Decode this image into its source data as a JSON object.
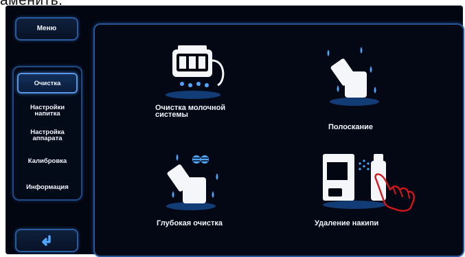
{
  "top_caption": "аменить.",
  "menu": {
    "label": "Меню"
  },
  "sidebar": {
    "items": [
      {
        "label": "Очистка",
        "active": true
      },
      {
        "label": "Настройки напитка",
        "active": false
      },
      {
        "label": "Настройка аппарата",
        "active": false
      },
      {
        "label": "Калибровка",
        "active": false
      },
      {
        "label": "Информация",
        "active": false
      }
    ]
  },
  "back_button": {
    "icon": "back-arrow-icon"
  },
  "tiles": [
    {
      "label": "Очистка молочной системы",
      "icon": "milk-system-cleaning-icon"
    },
    {
      "label": "Полоскание",
      "icon": "rinsing-icon"
    },
    {
      "label": "Глубокая очистка",
      "icon": "deep-cleaning-icon"
    },
    {
      "label": "Удаление накипи",
      "icon": "descaling-icon"
    }
  ],
  "colors": {
    "accent": "#2a5ba0",
    "glow": "#4ea6ff",
    "background": "#020611",
    "pointer": "#d4161c"
  }
}
